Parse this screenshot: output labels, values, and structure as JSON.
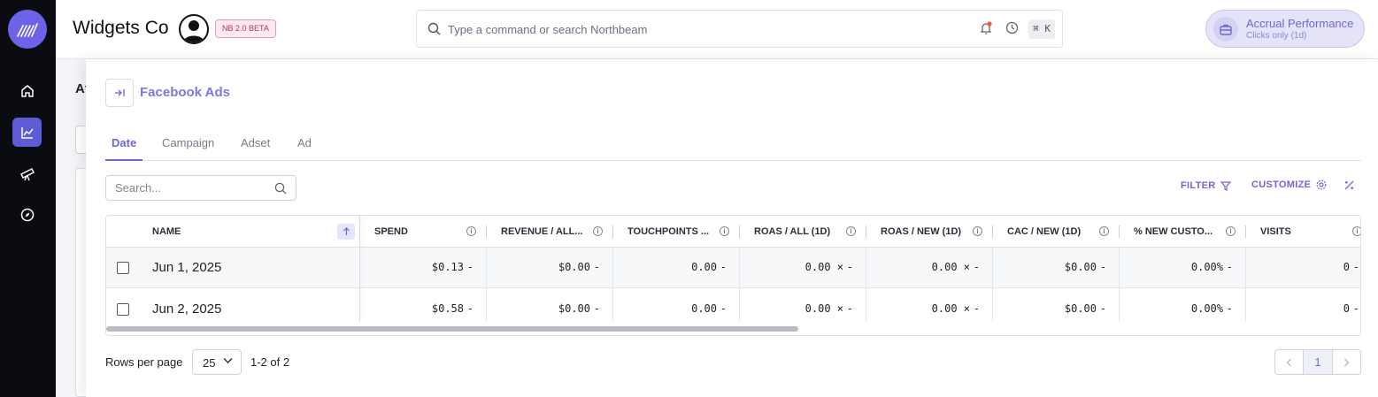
{
  "app": {
    "brand": "Widgets Co",
    "beta_badge": "NB 2.0 BETA",
    "command_placeholder": "Type a command or search Northbeam",
    "shortcut": "⌘ K",
    "accrual": {
      "title": "Accrual Performance",
      "subtitle": "Clicks only (1d)"
    },
    "accent_color": "#6c68d8"
  },
  "sidebar": {
    "items": [
      {
        "icon": "home-icon",
        "active": false
      },
      {
        "icon": "chart-line-icon",
        "active": true
      },
      {
        "icon": "telescope-icon",
        "active": false
      },
      {
        "icon": "compass-icon",
        "active": false
      }
    ]
  },
  "background_page": {
    "title_fragment": "At"
  },
  "panel": {
    "title": "Facebook Ads",
    "tabs": [
      "Date",
      "Campaign",
      "Adset",
      "Ad"
    ],
    "active_tab": "Date",
    "search_placeholder": "Search...",
    "filter_label": "FILTER",
    "customize_label": "CUSTOMIZE",
    "table": {
      "name_header": "NAME",
      "columns": [
        "SPEND",
        "REVENUE / ALL...",
        "TOUCHPOINTS ...",
        "ROAS / ALL (1D)",
        "ROAS / NEW (1D)",
        "CAC / NEW (1D)",
        "% NEW CUSTO...",
        "VISITS"
      ],
      "rows": [
        {
          "name": "Jun 1, 2025",
          "values": [
            "$0.13",
            "$0.00",
            "0.00",
            "0.00 ×",
            "0.00 ×",
            "$0.00",
            "0.00%",
            "0"
          ],
          "delta": "-"
        },
        {
          "name": "Jun 2, 2025",
          "values": [
            "$0.58",
            "$0.00",
            "0.00",
            "0.00 ×",
            "0.00 ×",
            "$0.00",
            "0.00%",
            "0"
          ],
          "delta": "-"
        }
      ]
    },
    "footer": {
      "rows_per_page_label": "Rows per page",
      "rows_per_page": "25",
      "range": "1-2 of 2",
      "page": "1"
    }
  }
}
